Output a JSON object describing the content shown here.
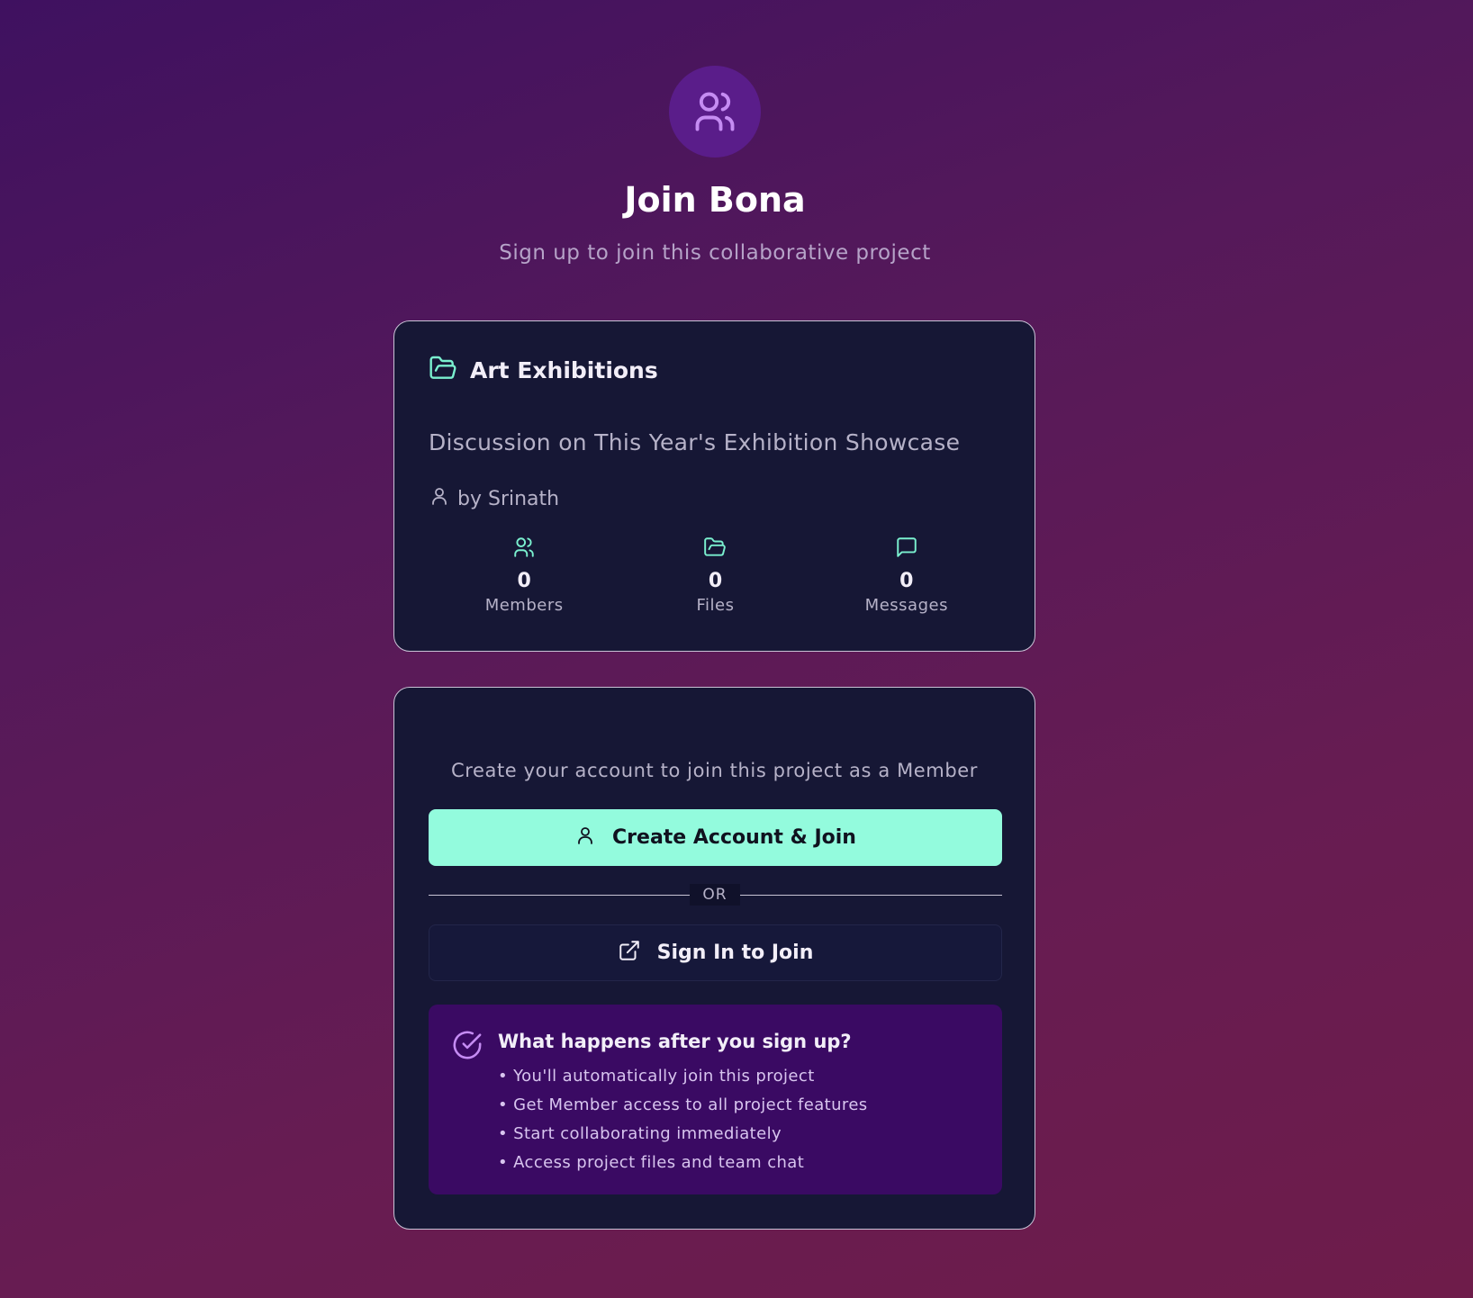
{
  "header": {
    "icon": "users-icon",
    "title": "Join Bona",
    "subtitle": "Sign up to join this collaborative project"
  },
  "project": {
    "icon": "folder-open-icon",
    "name": "Art Exhibitions",
    "description": "Discussion on This Year's Exhibition Showcase",
    "author": "by Srinath",
    "stats": [
      {
        "icon": "users-icon",
        "value": "0",
        "label": "Members"
      },
      {
        "icon": "folder-open-icon",
        "value": "0",
        "label": "Files"
      },
      {
        "icon": "message-square-icon",
        "value": "0",
        "label": "Messages"
      }
    ]
  },
  "join": {
    "prompt": "Create your account to join this project as a Member",
    "create_button_label": "Create Account & Join",
    "divider_label": "OR",
    "signin_button_label": "Sign In to Join",
    "info": {
      "title": "What happens after you sign up?",
      "items": [
        "You'll automatically join this project",
        "Get Member access to all project features",
        "Start collaborating immediately",
        "Access project files and team chat"
      ]
    }
  },
  "colors": {
    "accent": "#93fbdd",
    "card_bg": "#161735",
    "info_bg": "#3a0a63",
    "hero_icon_bg": "#5a1d8a",
    "hero_icon_stroke": "#c58cf3",
    "icon_teal": "#7af0cf"
  }
}
